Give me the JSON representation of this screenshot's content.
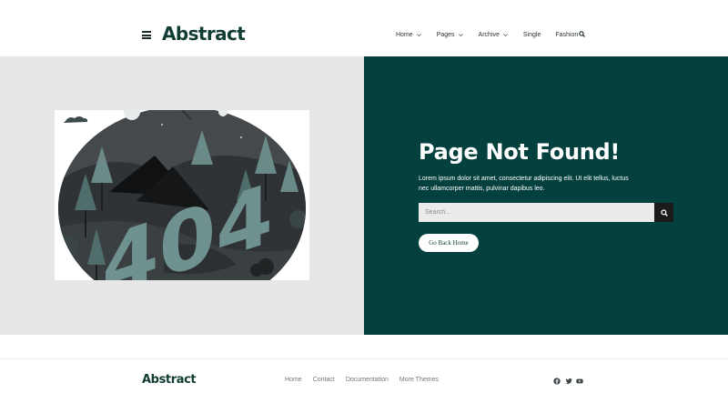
{
  "header": {
    "logo": "Abstract",
    "nav": [
      {
        "label": "Home",
        "dropdown": true
      },
      {
        "label": "Pages",
        "dropdown": true
      },
      {
        "label": "Archive",
        "dropdown": true
      },
      {
        "label": "Single",
        "dropdown": false
      },
      {
        "label": "Fashion",
        "dropdown": false
      }
    ],
    "icons": {
      "menu": "hamburger-icon",
      "search": "search-icon",
      "chevron": "chevron-down-icon"
    }
  },
  "hero": {
    "illustration_text": "404",
    "title": "Page Not Found!",
    "description": "Lorem ipsum dolor sit amet, consectetur adipiscing elit. Ut elit tellus, luctus nec ullamcorper mattis, pulvinar dapibus leo.",
    "search": {
      "placeholder": "Search..."
    },
    "button_label": "Go Back Home"
  },
  "footer": {
    "logo": "Abstract",
    "links": [
      "Home",
      "Contact",
      "Documentation",
      "More Themes"
    ],
    "social": [
      "facebook-icon",
      "twitter-icon",
      "youtube-icon"
    ]
  },
  "colors": {
    "brand": "#103c34",
    "hero_panel": "#03403e",
    "hero_left_bg": "#e7e7e7",
    "search_button": "#1b1b1b"
  }
}
